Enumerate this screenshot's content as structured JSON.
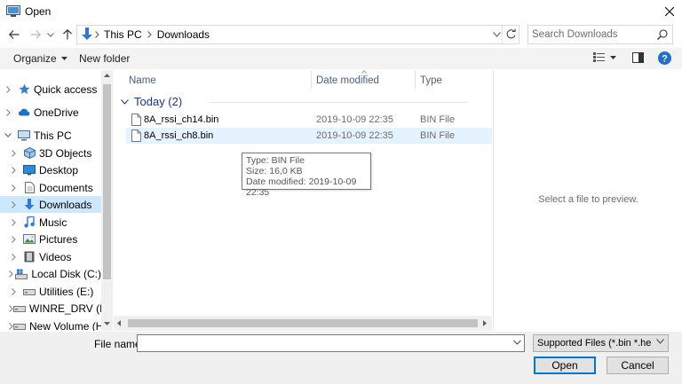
{
  "window": {
    "title": "Open",
    "app_icon": "folder-window-icon",
    "close_icon": "close-icon"
  },
  "address": {
    "crumbs": [
      "This PC",
      "Downloads"
    ],
    "search_placeholder": "Search Downloads"
  },
  "toolbar": {
    "organize_label": "Organize",
    "new_folder_label": "New folder"
  },
  "nav": {
    "items": [
      {
        "label": "Quick access",
        "icon": "star-icon",
        "indent": 0,
        "selected": false
      },
      {
        "label": "OneDrive",
        "icon": "cloud-icon",
        "indent": 0,
        "selected": false
      },
      {
        "label": "This PC",
        "icon": "computer-icon",
        "indent": 0,
        "selected": false,
        "expanded": true
      },
      {
        "label": "3D Objects",
        "icon": "cube-icon",
        "indent": 1,
        "selected": false
      },
      {
        "label": "Desktop",
        "icon": "desktop-icon",
        "indent": 1,
        "selected": false
      },
      {
        "label": "Documents",
        "icon": "document-icon",
        "indent": 1,
        "selected": false
      },
      {
        "label": "Downloads",
        "icon": "download-arrow-icon",
        "indent": 1,
        "selected": true
      },
      {
        "label": "Music",
        "icon": "music-note-icon",
        "indent": 1,
        "selected": false
      },
      {
        "label": "Pictures",
        "icon": "picture-icon",
        "indent": 1,
        "selected": false
      },
      {
        "label": "Videos",
        "icon": "film-icon",
        "indent": 1,
        "selected": false
      },
      {
        "label": "Local Disk (C:)",
        "icon": "windows-drive-icon",
        "indent": 1,
        "selected": false
      },
      {
        "label": "Utilities (E:)",
        "icon": "drive-icon",
        "indent": 1,
        "selected": false
      },
      {
        "label": "WINRE_DRV (F:)",
        "icon": "drive-icon",
        "indent": 1,
        "selected": false
      },
      {
        "label": "New Volume (H:",
        "icon": "drive-icon",
        "indent": 1,
        "selected": false
      }
    ]
  },
  "list": {
    "columns": [
      "Name",
      "Date modified",
      "Type"
    ],
    "group_label": "Today (2)",
    "files": [
      {
        "name": "8A_rssi_ch14.bin",
        "date": "2019-10-09 22:35",
        "type": "BIN File"
      },
      {
        "name": "8A_rssi_ch8.bin",
        "date": "2019-10-09 22:35",
        "type": "BIN File"
      }
    ]
  },
  "tooltip": {
    "lines": [
      "Type: BIN File",
      "Size: 16,0 KB",
      "Date modified: 2019-10-09 22:35"
    ]
  },
  "preview": {
    "message": "Select a file to preview."
  },
  "footer": {
    "filename_label": "File name:",
    "filename_value": "",
    "filetype_value": "Supported Files (*.bin *.hex *.sr",
    "open_label": "Open",
    "cancel_label": "Cancel"
  },
  "colors": {
    "accent": "#0078d7",
    "selection": "#cce8ff",
    "hover": "#e5f3ff",
    "group_header": "#1e3287"
  }
}
